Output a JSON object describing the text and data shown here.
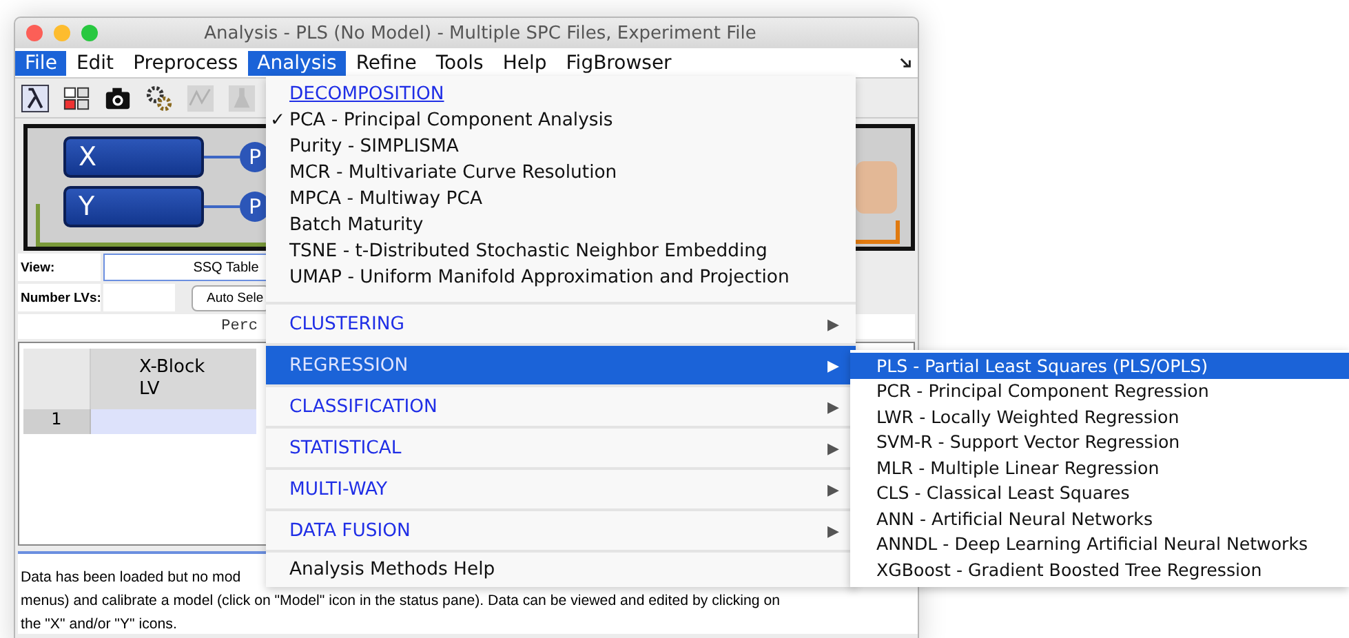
{
  "window": {
    "title": "Analysis - PLS (No Model) - Multiple SPC Files, Experiment File"
  },
  "menubar": [
    {
      "label": "File",
      "selected": true
    },
    {
      "label": "Edit",
      "selected": false
    },
    {
      "label": "Preprocess",
      "selected": false
    },
    {
      "label": "Analysis",
      "selected": true
    },
    {
      "label": "Refine",
      "selected": false
    },
    {
      "label": "Tools",
      "selected": false
    },
    {
      "label": "Help",
      "selected": false
    },
    {
      "label": "FigBrowser",
      "selected": false
    }
  ],
  "workflow": {
    "blocks": [
      {
        "label": "X",
        "node": "P"
      },
      {
        "label": "Y",
        "node": "P"
      }
    ]
  },
  "view": {
    "label": "View:",
    "value": "SSQ Table"
  },
  "number_lvs": {
    "label": "Number LVs:",
    "button": "Auto Sele"
  },
  "table": {
    "caption": "Perc",
    "columns": [
      {
        "label": "X-Block",
        "sublabel": "LV"
      }
    ],
    "rows": [
      {
        "index": "1",
        "selected": true
      }
    ]
  },
  "status_lines": [
    "Data has been loaded but no mod",
    "menus) and calibrate a model (click on \"Model\" icon in the status pane). Data can be viewed and edited by clicking on",
    "the \"X\" and/or \"Y\" icons."
  ],
  "analysis_menu": {
    "check_mark": "✓",
    "items": [
      {
        "kind": "header",
        "label": "DECOMPOSITION"
      },
      {
        "kind": "item",
        "label": "PCA - Principal Component Analysis",
        "checked": true
      },
      {
        "kind": "item",
        "label": "Purity - SIMPLISMA",
        "checked": false
      },
      {
        "kind": "item",
        "label": "MCR - Multivariate Curve Resolution",
        "checked": false
      },
      {
        "kind": "item",
        "label": "MPCA - Multiway PCA",
        "checked": false
      },
      {
        "kind": "item",
        "label": "Batch Maturity",
        "checked": false
      },
      {
        "kind": "item",
        "label": "TSNE - t-Distributed Stochastic Neighbor Embedding",
        "checked": false
      },
      {
        "kind": "item",
        "label": "UMAP - Uniform Manifold Approximation and Projection",
        "checked": false
      },
      {
        "kind": "submenu",
        "label": "CLUSTERING",
        "selected": false,
        "arrow": "▶"
      },
      {
        "kind": "submenu",
        "label": "REGRESSION",
        "selected": true,
        "arrow": "▶"
      },
      {
        "kind": "submenu",
        "label": "CLASSIFICATION",
        "selected": false,
        "arrow": "▶"
      },
      {
        "kind": "submenu",
        "label": "STATISTICAL",
        "selected": false,
        "arrow": "▶"
      },
      {
        "kind": "submenu",
        "label": "MULTI-WAY",
        "selected": false,
        "arrow": "▶"
      },
      {
        "kind": "submenu",
        "label": "DATA FUSION",
        "selected": false,
        "arrow": "▶"
      },
      {
        "kind": "help",
        "label": "Analysis Methods Help"
      }
    ]
  },
  "regression_menu": {
    "items": [
      {
        "label": "PLS - Partial Least Squares (PLS/OPLS)",
        "selected": true
      },
      {
        "label": "PCR - Principal Component Regression",
        "selected": false
      },
      {
        "label": "LWR - Locally Weighted Regression",
        "selected": false
      },
      {
        "label": "SVM-R - Support Vector Regression",
        "selected": false
      },
      {
        "label": "MLR - Multiple Linear Regression",
        "selected": false
      },
      {
        "label": "CLS - Classical Least Squares",
        "selected": false
      },
      {
        "label": "ANN - Artificial Neural Networks",
        "selected": false
      },
      {
        "label": "ANNDL - Deep Learning Artificial Neural Networks",
        "selected": false
      },
      {
        "label": "XGBoost - Gradient Boosted Tree Regression",
        "selected": false
      }
    ]
  }
}
